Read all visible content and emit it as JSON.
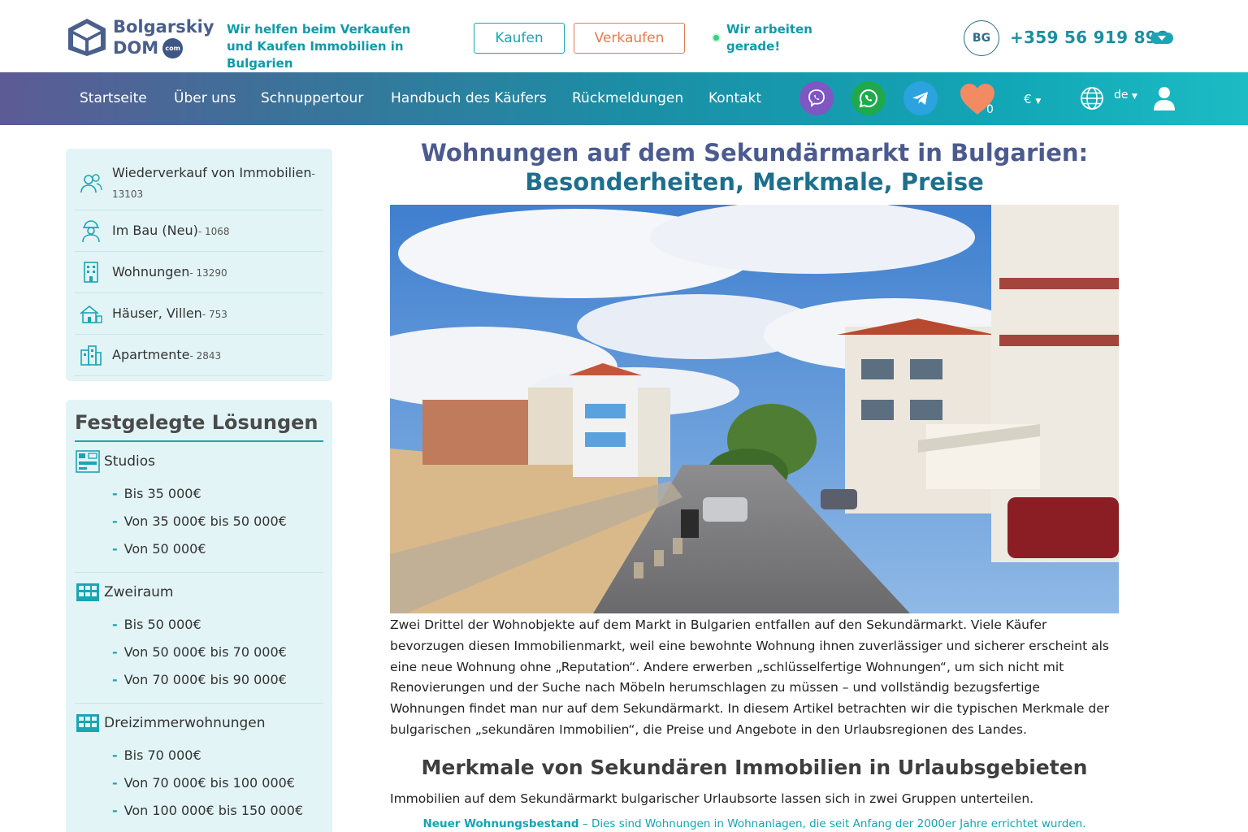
{
  "header": {
    "logo_top": "Bolgarskiy",
    "logo_bottom": "DOM",
    "logo_badge": "com",
    "tagline": "Wir helfen beim Verkaufen und Kaufen Immobilien in Bulgarien",
    "btn_buy": "Kaufen",
    "btn_sell": "Verkaufen",
    "status": "Wir arbeiten gerade!",
    "lang_code": "BG",
    "phone": "+359 56 919 898"
  },
  "nav": {
    "items": [
      "Startseite",
      "Über uns",
      "Schnuppertour",
      "Handbuch des Käufers",
      "Rückmeldungen",
      "Kontakt"
    ],
    "favorites_count": "0",
    "currency": "€",
    "language": "de"
  },
  "sidebar": {
    "categories": [
      {
        "label": "Wiederverkauf von Immobilien",
        "count": "- 13103"
      },
      {
        "label": "Im Bau (Neu)",
        "count": "- 1068"
      },
      {
        "label": "Wohnungen",
        "count": "- 13290"
      },
      {
        "label": "Häuser, Villen",
        "count": "- 753"
      },
      {
        "label": "Apartmente",
        "count": "- 2843"
      }
    ],
    "solutions_title": "Festgelegte Lösungen",
    "solutions": [
      {
        "name": "Studios",
        "links": [
          "Bis 35 000€",
          "Von 35 000€ bis 50 000€",
          "Von 50 000€"
        ]
      },
      {
        "name": "Zweiraum",
        "links": [
          "Bis 50 000€",
          "Von 50 000€ bis 70 000€",
          "Von 70 000€ bis 90 000€"
        ]
      },
      {
        "name": "Dreizimmerwohnungen",
        "links": [
          "Bis 70 000€",
          "Von 70 000€ bis 100 000€",
          "Von 100 000€ bis 150 000€"
        ]
      }
    ]
  },
  "article": {
    "title_line1": "Wohnungen auf dem Sekundärmarkt in Bulgarien:",
    "title_line2": "Besonderheiten, Merkmale, Preise",
    "intro": "Zwei Drittel der Wohnobjekte auf dem Markt in Bulgarien entfallen auf den Sekundärmarkt. Viele Käufer bevorzugen diesen Immobilienmarkt, weil eine bewohnte Wohnung ihnen zuverlässiger und sicherer erscheint als eine neue Wohnung ohne „Reputation“. Andere erwerben „schlüsselfertige Wohnungen“, um sich nicht mit Renovierungen und der Suche nach Möbeln herumschlagen zu müssen – und vollständig bezugsfertige Wohnungen findet man nur auf dem Sekundärmarkt. In diesem Artikel betrachten wir die typischen Merkmale der bulgarischen „sekundären Immobilien“, die Preise und Angebote in den Urlaubsregionen des Landes.",
    "heading2": "Merkmale von Sekundären Immobilien in Urlaubsgebieten",
    "para2": "Immobilien auf dem Sekundärmarkt bulgarischer Urlaubsorte lassen sich in zwei Gruppen unterteilen.",
    "para3_bold": "Neuer Wohnungsbestand",
    "para3_rest": " – Dies sind Wohnungen in Wohnanlagen, die seit Anfang der 2000er Jahre errichtet wurden."
  }
}
